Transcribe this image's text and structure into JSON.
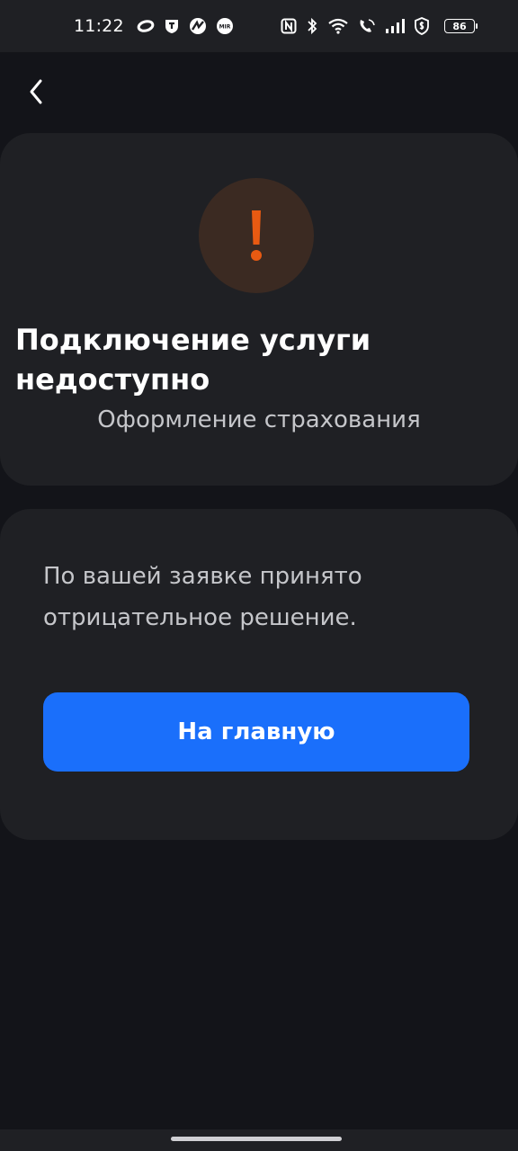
{
  "status_bar": {
    "time": "11:22",
    "left_icons": [
      "ring-icon",
      "t-shield-icon",
      "bolt-app-icon",
      "mir-icon"
    ],
    "mir_label": "MIR",
    "right_icons": [
      "nfc-icon",
      "bluetooth-icon",
      "wifi-icon",
      "call-icon",
      "signal-icon",
      "dollar-shield-icon"
    ],
    "battery": "86"
  },
  "header": {
    "back_icon": "chevron-left-icon"
  },
  "status_card": {
    "icon": "exclamation-icon",
    "title": "Подключение услуги недоступно",
    "subtitle": "Оформление страхования"
  },
  "result_card": {
    "message": "По вашей заявке принято отрицательное решение.",
    "home_button_label": "На главную"
  },
  "colors": {
    "background": "#131419",
    "card": "#1f2024",
    "accent": "#1a6ffb",
    "warning": "#e85a12",
    "warning_bg": "#3b2a22",
    "muted_text": "#c5c6ca"
  }
}
